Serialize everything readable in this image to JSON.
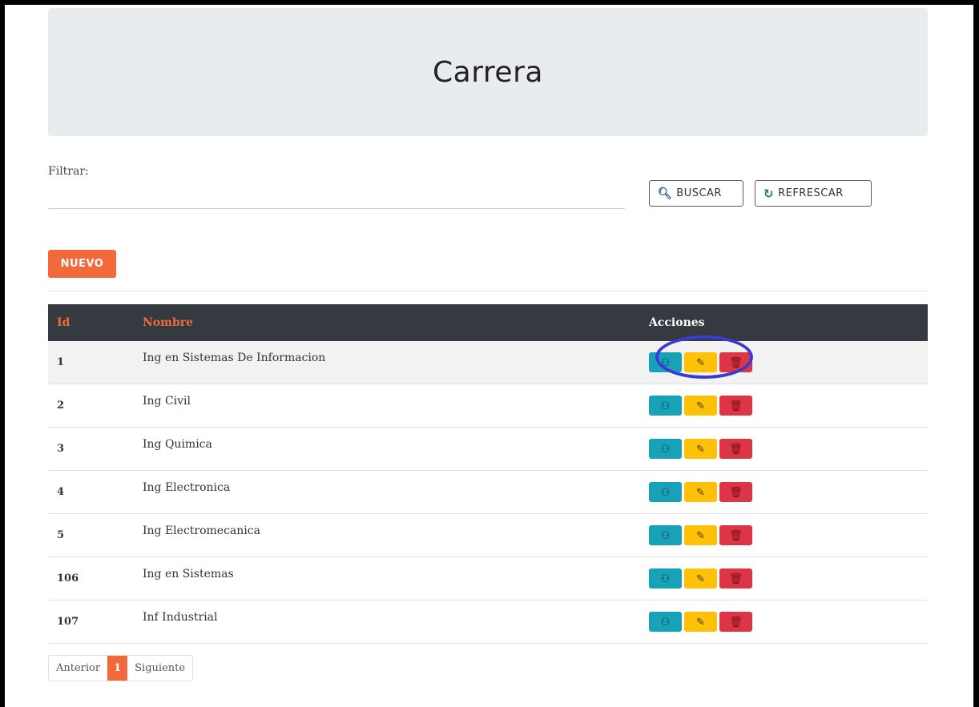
{
  "header": {
    "title": "Carrera"
  },
  "filter": {
    "label": "Filtrar:",
    "value": "",
    "placeholder": ""
  },
  "buttons": {
    "buscar": "BUSCAR",
    "refrescar": "REFRESCAR",
    "nuevo": "NUEVO"
  },
  "table": {
    "headers": {
      "id": "Id",
      "nombre": "Nombre",
      "acciones": "Acciones"
    },
    "rows": [
      {
        "id": "1",
        "nombre": "Ing en Sistemas De Informacion"
      },
      {
        "id": "2",
        "nombre": "Ing Civil"
      },
      {
        "id": "3",
        "nombre": "Ing Quimica"
      },
      {
        "id": "4",
        "nombre": "Ing Electronica"
      },
      {
        "id": "5",
        "nombre": "Ing Electromecanica"
      },
      {
        "id": "106",
        "nombre": "Ing en Sistemas"
      },
      {
        "id": "107",
        "nombre": "Inf Industrial"
      }
    ],
    "action_icons": [
      "binoculars-icon",
      "pencil-icon",
      "trash-icon"
    ]
  },
  "pagination": {
    "prev": "Anterior",
    "current": "1",
    "next": "Siguiente"
  },
  "colors": {
    "accent": "#f26a3b",
    "view": "#17a2b8",
    "edit": "#ffc107",
    "delete": "#dc3545",
    "annotation": "#3b3bd4"
  }
}
